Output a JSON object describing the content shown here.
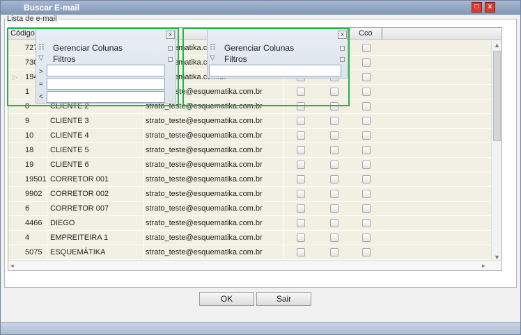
{
  "window": {
    "title": "Buscar E-mail",
    "btn_maximize": "□",
    "btn_close": "x"
  },
  "fieldset": {
    "legend": "Lista de e-mail"
  },
  "grid": {
    "columns": {
      "codigo": "Código",
      "cco": "Cco"
    },
    "rows": [
      {
        "codigo": "727",
        "nome": "",
        "email": "e@esquematika.com.br"
      },
      {
        "codigo": "730",
        "nome": "",
        "email": "e@esquematika.com.br"
      },
      {
        "codigo": "194",
        "nome": "",
        "email": "e@esquematika.com.br"
      },
      {
        "codigo": "1",
        "nome": "",
        "email": "strato_teste@esquematika.com.br"
      },
      {
        "codigo": "8",
        "nome": "CLIENTE 2",
        "email": "strato_teste@esquematika.com.br"
      },
      {
        "codigo": "9",
        "nome": "CLIENTE 3",
        "email": "strato_teste@esquematika.com.br"
      },
      {
        "codigo": "10",
        "nome": "CLIENTE 4",
        "email": "strato_teste@esquematika.com.br"
      },
      {
        "codigo": "18",
        "nome": "CLIENTE 5",
        "email": "strato_teste@esquematika.com.br"
      },
      {
        "codigo": "19",
        "nome": "CLIENTE 6",
        "email": "strato_teste@esquematika.com.br"
      },
      {
        "codigo": "19501",
        "nome": "CORRETOR 001",
        "email": "strato_teste@esquematika.com.br"
      },
      {
        "codigo": "9902",
        "nome": "CORRETOR 002",
        "email": "strato_teste@esquematika.com.br"
      },
      {
        "codigo": "6",
        "nome": "CORRETOR 007",
        "email": "strato_teste@esquematika.com.br"
      },
      {
        "codigo": "4466",
        "nome": "DIEGO",
        "email": "strato_teste@esquematika.com.br"
      },
      {
        "codigo": "4",
        "nome": "EMPREITEIRA 1",
        "email": "strato_teste@esquematika.com.br"
      },
      {
        "codigo": "5075",
        "nome": "ESQUEMÁTIKA",
        "email": "strato_teste@esquematika.com.br"
      }
    ]
  },
  "popup_left": {
    "close": "x",
    "gerenciar": "Gerenciar Colunas",
    "filtros": "Filtros",
    "op_gt": ">",
    "op_eq": "=",
    "op_lt": "<"
  },
  "popup_right": {
    "close": "x",
    "gerenciar": "Gerenciar Colunas",
    "filtros": "Filtros"
  },
  "buttons": {
    "ok": "OK",
    "sair": "Sair"
  },
  "colors": {
    "highlight": "#22b14c",
    "title_bg": "#8197b6",
    "row_bg": "#f1f0e3"
  },
  "icons": {
    "columns": "list-icon",
    "filter": "funnel-icon",
    "row_pointer": "triangle-right-icon"
  }
}
